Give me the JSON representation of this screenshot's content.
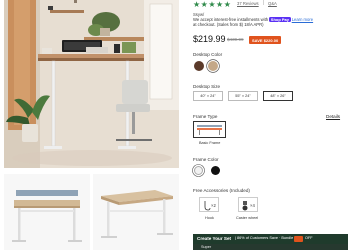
{
  "rating": {
    "stars": "★★★★★",
    "reviews_link": "37 Reviews",
    "qa_link": "Q&A",
    "separator": "|"
  },
  "promo": {
    "tag": "Ssyw/",
    "line1": "We accept interest-free installments with",
    "shop_pay": "Shop Pay",
    "line2": "at checkout. (Sales from $) 18/A APR)",
    "learn_more": "Learn more"
  },
  "price": {
    "current": "$219.99",
    "compare": "$439.99",
    "save_badge": "SAVE $220.00"
  },
  "desktop_color": {
    "label": "Desktop Color",
    "options": [
      "walnut",
      "oak"
    ],
    "selected": "oak"
  },
  "desktop_size": {
    "label": "Desktop Size",
    "options": [
      "40\" × 24\"",
      "55\" × 24\"",
      "48\" × 26\""
    ],
    "selected": "48\" × 26\""
  },
  "frame_type": {
    "label": "Frame Type",
    "details_link": "Details",
    "option_label": "Basic Frame"
  },
  "frame_color": {
    "label": "Frame Color",
    "options": [
      "white",
      "black"
    ],
    "selected": "white"
  },
  "accessories": {
    "label": "Free Accessories (Included)",
    "items": [
      {
        "label": "Hook",
        "qty": "×2"
      },
      {
        "label": "Caster wheel",
        "qty": "×4"
      }
    ]
  },
  "bundle": {
    "title": "Create Your Set",
    "offer": "| 86% of Customers Save · Bundle &",
    "off": "OFF",
    "row_label": "Super"
  },
  "colors": {
    "accent": "#e0531d",
    "star": "#2f8a4a",
    "bundle_bg": "#1f3b2c"
  }
}
